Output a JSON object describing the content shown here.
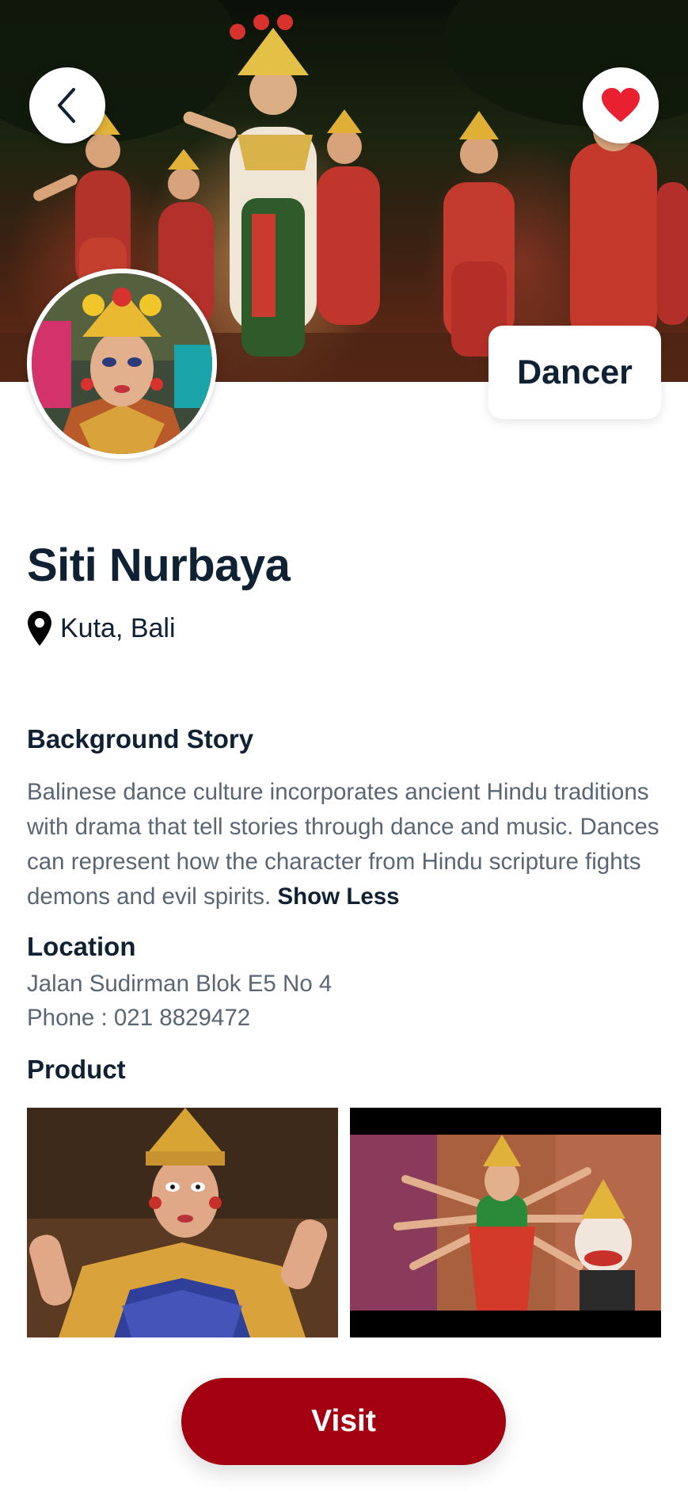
{
  "header": {
    "back_icon": "chevron-left-icon",
    "favorite_icon": "heart-icon",
    "favorite_color": "#e8202f"
  },
  "profile": {
    "category": "Dancer",
    "name": "Siti Nurbaya",
    "location_icon": "map-pin-icon",
    "location": "Kuta, Bali"
  },
  "background_story": {
    "title": "Background Story",
    "text": "Balinese dance culture incorporates ancient Hindu traditions with drama that tell stories through dance and music. Dances can represent how the character from Hindu scripture fights demons and evil spirits.",
    "toggle_label": "Show Less"
  },
  "location_section": {
    "title": "Location",
    "address": "Jalan Sudirman Blok E5 No 4",
    "phone": "Phone : 021 8829472"
  },
  "product_section": {
    "title": "Product"
  },
  "actions": {
    "visit_label": "Visit",
    "accent_color": "#a30012"
  }
}
